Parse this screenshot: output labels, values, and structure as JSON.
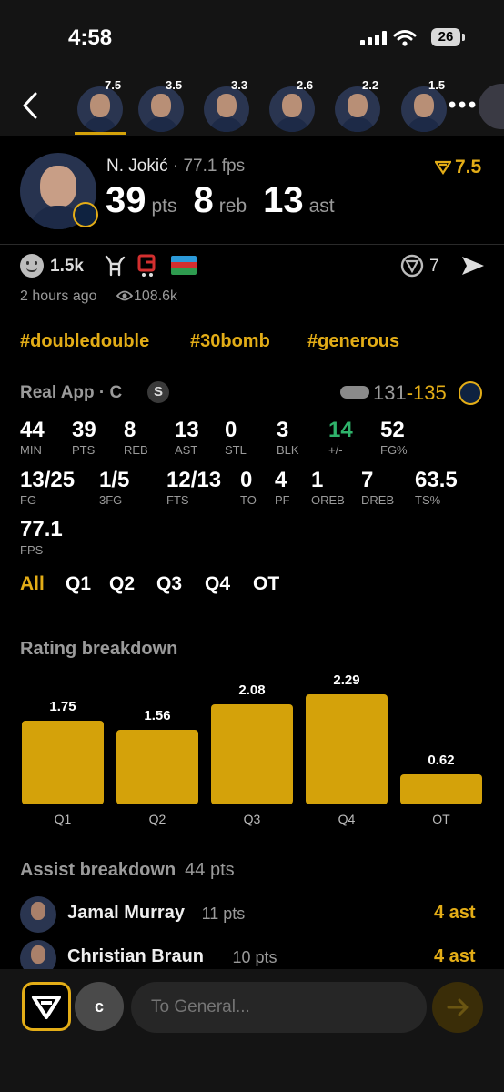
{
  "status": {
    "time": "4:58",
    "battery": "26"
  },
  "players_strip": [
    {
      "score": "7.5",
      "name": "jokic"
    },
    {
      "score": "3.5",
      "name": "player-2"
    },
    {
      "score": "3.3",
      "name": "player-3"
    },
    {
      "score": "2.6",
      "name": "player-4"
    },
    {
      "score": "2.2",
      "name": "player-5"
    },
    {
      "score": "1.5",
      "name": "player-6"
    }
  ],
  "header": {
    "name": "N. Jokić",
    "fps": "77.1 fps",
    "rating": "7.5",
    "pts_val": "39",
    "pts_lbl": "pts",
    "reb_val": "8",
    "reb_lbl": "reb",
    "ast_val": "13",
    "ast_lbl": "ast"
  },
  "social": {
    "reactions": "1.5k",
    "shares": "7",
    "time_ago": "2 hours ago",
    "views": "108.6k"
  },
  "hashtags": [
    "#doubledouble",
    "#30bomb",
    "#generous"
  ],
  "game": {
    "source": "Real App · C",
    "badge": "S",
    "score_opp": "131",
    "score_dash": "-",
    "score_own": "135"
  },
  "stats_row1": [
    {
      "v": "44",
      "l": "MIN"
    },
    {
      "v": "39",
      "l": "PTS"
    },
    {
      "v": "8",
      "l": "REB"
    },
    {
      "v": "13",
      "l": "AST"
    },
    {
      "v": "0",
      "l": "STL"
    },
    {
      "v": "3",
      "l": "BLK"
    },
    {
      "v": "14",
      "l": "+/-"
    },
    {
      "v": "52",
      "l": "FG%"
    }
  ],
  "stats_row2": [
    {
      "v": "13/25",
      "l": "FG"
    },
    {
      "v": "1/5",
      "l": "3FG"
    },
    {
      "v": "12/13",
      "l": "FTS"
    },
    {
      "v": "0",
      "l": "TO"
    },
    {
      "v": "4",
      "l": "PF"
    },
    {
      "v": "1",
      "l": "OREB"
    },
    {
      "v": "7",
      "l": "DREB"
    },
    {
      "v": "63.5",
      "l": "TS%"
    }
  ],
  "stats_row3": [
    {
      "v": "77.1",
      "l": "FPS"
    }
  ],
  "quarter_tabs": [
    "All",
    "Q1",
    "Q2",
    "Q3",
    "Q4",
    "OT"
  ],
  "rating_breakdown": {
    "title": "Rating breakdown"
  },
  "chart_data": {
    "type": "bar",
    "categories": [
      "Q1",
      "Q2",
      "Q3",
      "Q4",
      "OT"
    ],
    "values": [
      1.75,
      1.56,
      2.08,
      2.29,
      0.62
    ],
    "labels": [
      "1.75",
      "1.56",
      "2.08",
      "2.29",
      "0.62"
    ],
    "title": "Rating breakdown",
    "ylim": [
      0,
      2.29
    ],
    "color": "#d4a20a"
  },
  "assists": {
    "title": "Assist breakdown",
    "total": "44 pts",
    "rows": [
      {
        "name": "Jamal Murray",
        "pts": "11 pts",
        "ast": "4 ast"
      },
      {
        "name": "Christian Braun",
        "pts": "10 pts",
        "ast": "4 ast"
      }
    ]
  },
  "compose": {
    "avatar_letter": "c",
    "placeholder": "To General..."
  },
  "colors": {
    "accent": "#e3ad17",
    "positive": "#2fb36b",
    "background": "#000000"
  }
}
